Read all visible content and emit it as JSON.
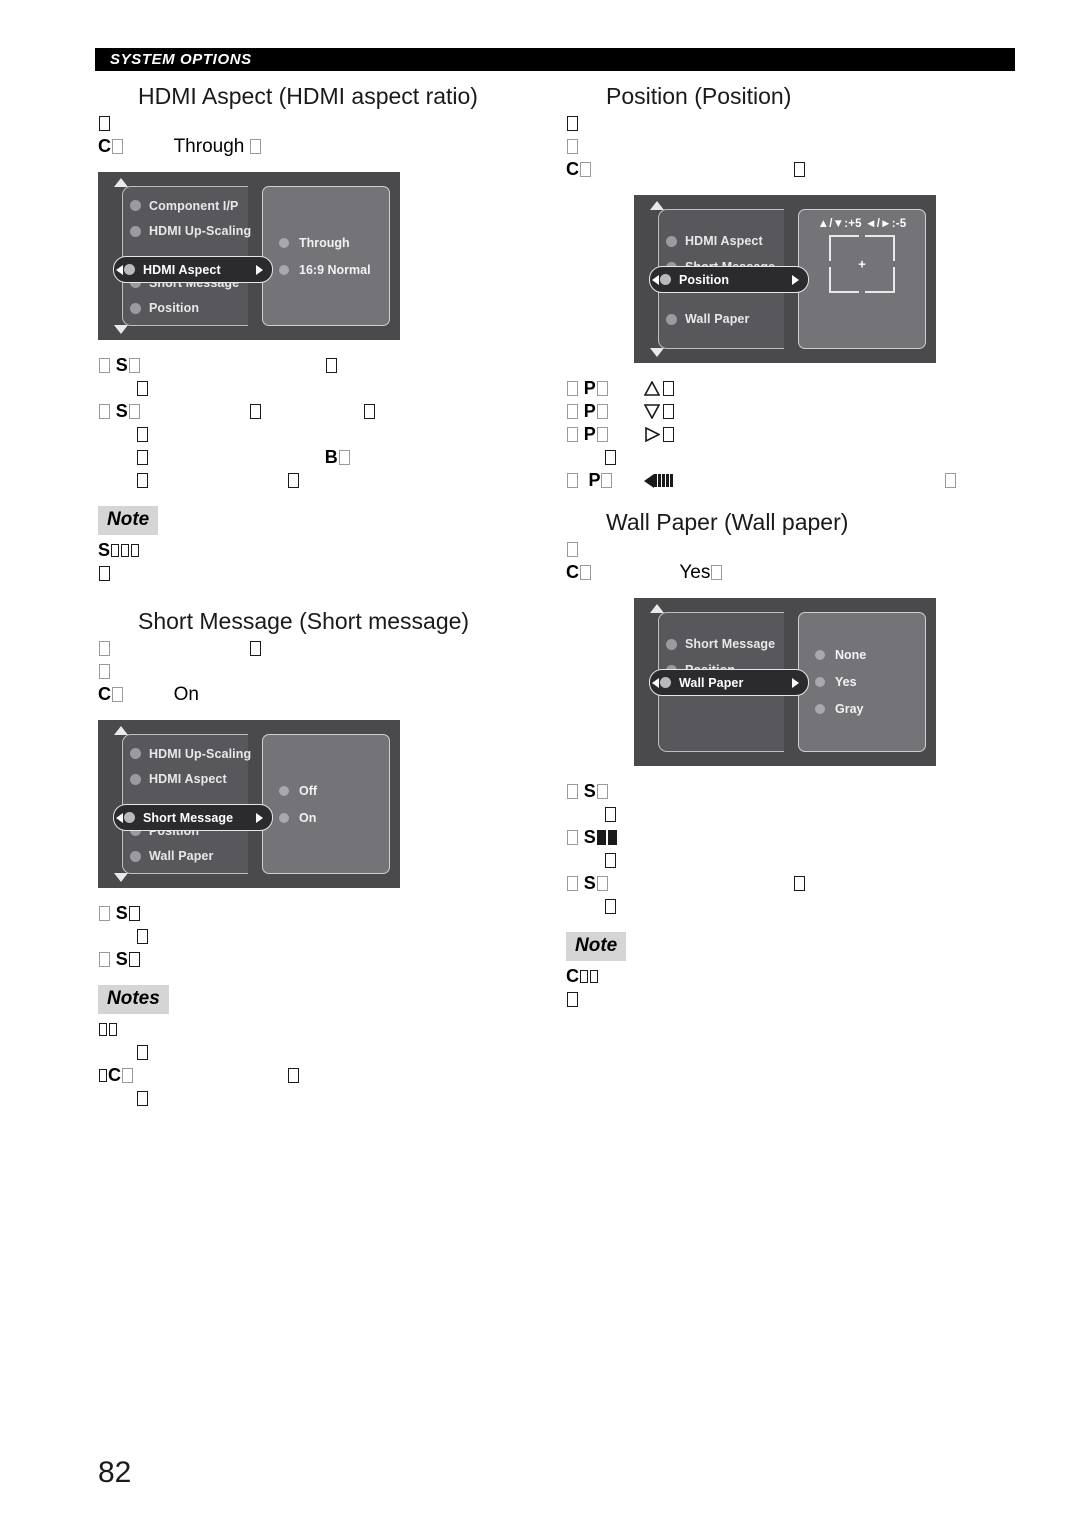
{
  "document": {
    "section_header": "SYSTEM OPTIONS",
    "page_number": "82"
  },
  "left_column": {
    "hdmi_aspect": {
      "heading": "HDMI Aspect (HDMI aspect ratio)",
      "intro_key": "C",
      "default_value": "Through",
      "osd": {
        "items": [
          {
            "label": "Component I/P",
            "selected": false
          },
          {
            "label": "HDMI Up-Scaling",
            "selected": false
          },
          {
            "label": "HDMI Aspect",
            "selected": true
          },
          {
            "label": "Short Message",
            "selected": false
          },
          {
            "label": "Position",
            "selected": false
          }
        ],
        "options": [
          {
            "label": "Through"
          },
          {
            "label": "16:9 Normal"
          }
        ]
      },
      "bullets": [
        {
          "key": "S"
        },
        {
          "key": "S"
        },
        {
          "key": "B"
        }
      ],
      "note_label": "Note",
      "note_key": "S"
    },
    "short_message": {
      "heading": "Short Message (Short message)",
      "intro_key": "C",
      "default_value": "On",
      "osd": {
        "items": [
          {
            "label": "HDMI Up-Scaling",
            "selected": false
          },
          {
            "label": "HDMI Aspect",
            "selected": false
          },
          {
            "label": "Short Message",
            "selected": true
          },
          {
            "label": "Position",
            "selected": false
          },
          {
            "label": "Wall Paper",
            "selected": false
          }
        ],
        "options": [
          {
            "label": "Off"
          },
          {
            "label": "On"
          }
        ]
      },
      "bullets": [
        {
          "key": "S"
        },
        {
          "key": "S"
        }
      ],
      "notes_label": "Notes",
      "notes_key": "C"
    }
  },
  "right_column": {
    "position": {
      "heading": "Position (Position)",
      "intro_key": "C",
      "osd": {
        "items": [
          {
            "label": "HDMI Aspect",
            "selected": false
          },
          {
            "label": "Short Message",
            "selected": false
          },
          {
            "label": "Position",
            "selected": true
          },
          {
            "label": "Wall Paper",
            "selected": false
          }
        ],
        "readout": "▲/▼:+5    ◄/►:-5",
        "crosshair": "+"
      },
      "bullets": [
        {
          "key": "P",
          "glyph": "triangle-up"
        },
        {
          "key": "P",
          "glyph": "triangle-down"
        },
        {
          "key": "P",
          "glyph": "triangle-right"
        },
        {
          "key": "P",
          "glyph": "arrow-bars-left"
        }
      ]
    },
    "wall_paper": {
      "heading": "Wall Paper (Wall paper)",
      "intro_key": "C",
      "default_value": "Yes",
      "osd": {
        "items": [
          {
            "label": "Short Message",
            "selected": false
          },
          {
            "label": "Position",
            "selected": false
          },
          {
            "label": "Wall Paper",
            "selected": true
          }
        ],
        "options": [
          {
            "label": "None"
          },
          {
            "label": "Yes"
          },
          {
            "label": "Gray"
          }
        ]
      },
      "bullets": [
        {
          "key": "S"
        },
        {
          "key": "S"
        },
        {
          "key": "S"
        }
      ],
      "note_label": "Note",
      "note_key": "C"
    }
  },
  "colors": {
    "header_bar": "#000000",
    "note_badge": "#d5d5d5",
    "osd_frame": "#4a4a4d",
    "osd_list": "#58585c",
    "osd_panel": "#737378",
    "osd_selected": "#2b2b2e",
    "osd_text": "#e8e8ea"
  }
}
